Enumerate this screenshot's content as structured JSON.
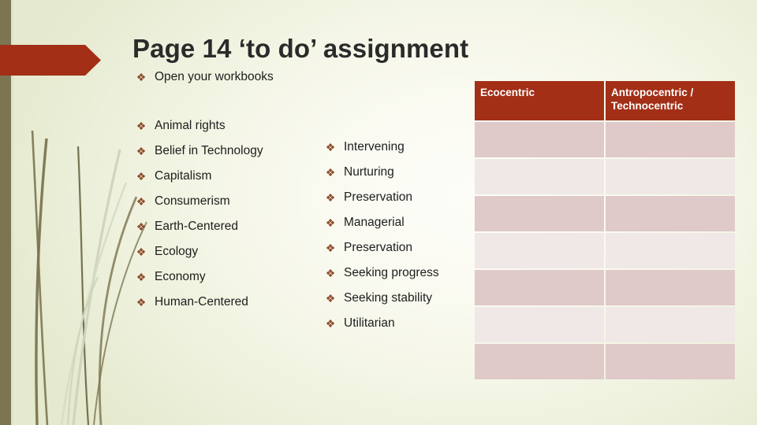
{
  "slide": {
    "title": "Page 14 ‘to do’ assignment",
    "background_color": "#e4e8cd",
    "accent_color": "#a32f17",
    "band_color": "#7b7552",
    "bullet_glyph": "❖",
    "bullet_color": "#8a4b2a"
  },
  "intro": {
    "items": [
      {
        "label": "Open your workbooks"
      }
    ]
  },
  "columns": {
    "left": {
      "items": [
        {
          "label": "Animal rights"
        },
        {
          "label": "Belief in Technology"
        },
        {
          "label": "Capitalism"
        },
        {
          "label": "Consumerism"
        },
        {
          "label": "Earth-Centered"
        },
        {
          "label": "Ecology"
        },
        {
          "label": "Economy"
        },
        {
          "label": "Human-Centered"
        }
      ]
    },
    "right": {
      "items": [
        {
          "label": "Intervening"
        },
        {
          "label": "Nurturing"
        },
        {
          "label": "Preservation"
        },
        {
          "label": "Managerial"
        },
        {
          "label": "Preservation"
        },
        {
          "label": "Seeking progress"
        },
        {
          "label": "Seeking stability"
        },
        {
          "label": "Utilitarian"
        }
      ]
    }
  },
  "table": {
    "headers": [
      "Ecocentric",
      "Antropocentric / Technocentric"
    ],
    "rows": [
      {
        "style": "dark",
        "cells": [
          "",
          ""
        ]
      },
      {
        "style": "light",
        "cells": [
          "",
          ""
        ]
      },
      {
        "style": "dark",
        "cells": [
          "",
          ""
        ]
      },
      {
        "style": "light",
        "cells": [
          "",
          ""
        ]
      },
      {
        "style": "dark",
        "cells": [
          "",
          ""
        ]
      },
      {
        "style": "light",
        "cells": [
          "",
          ""
        ]
      },
      {
        "style": "dark",
        "cells": [
          "",
          ""
        ]
      }
    ],
    "header_background": "#a32f17",
    "header_text_color": "#ffffff",
    "row_dark_color": "#dfc9c9",
    "row_light_color": "#efe8e6"
  }
}
